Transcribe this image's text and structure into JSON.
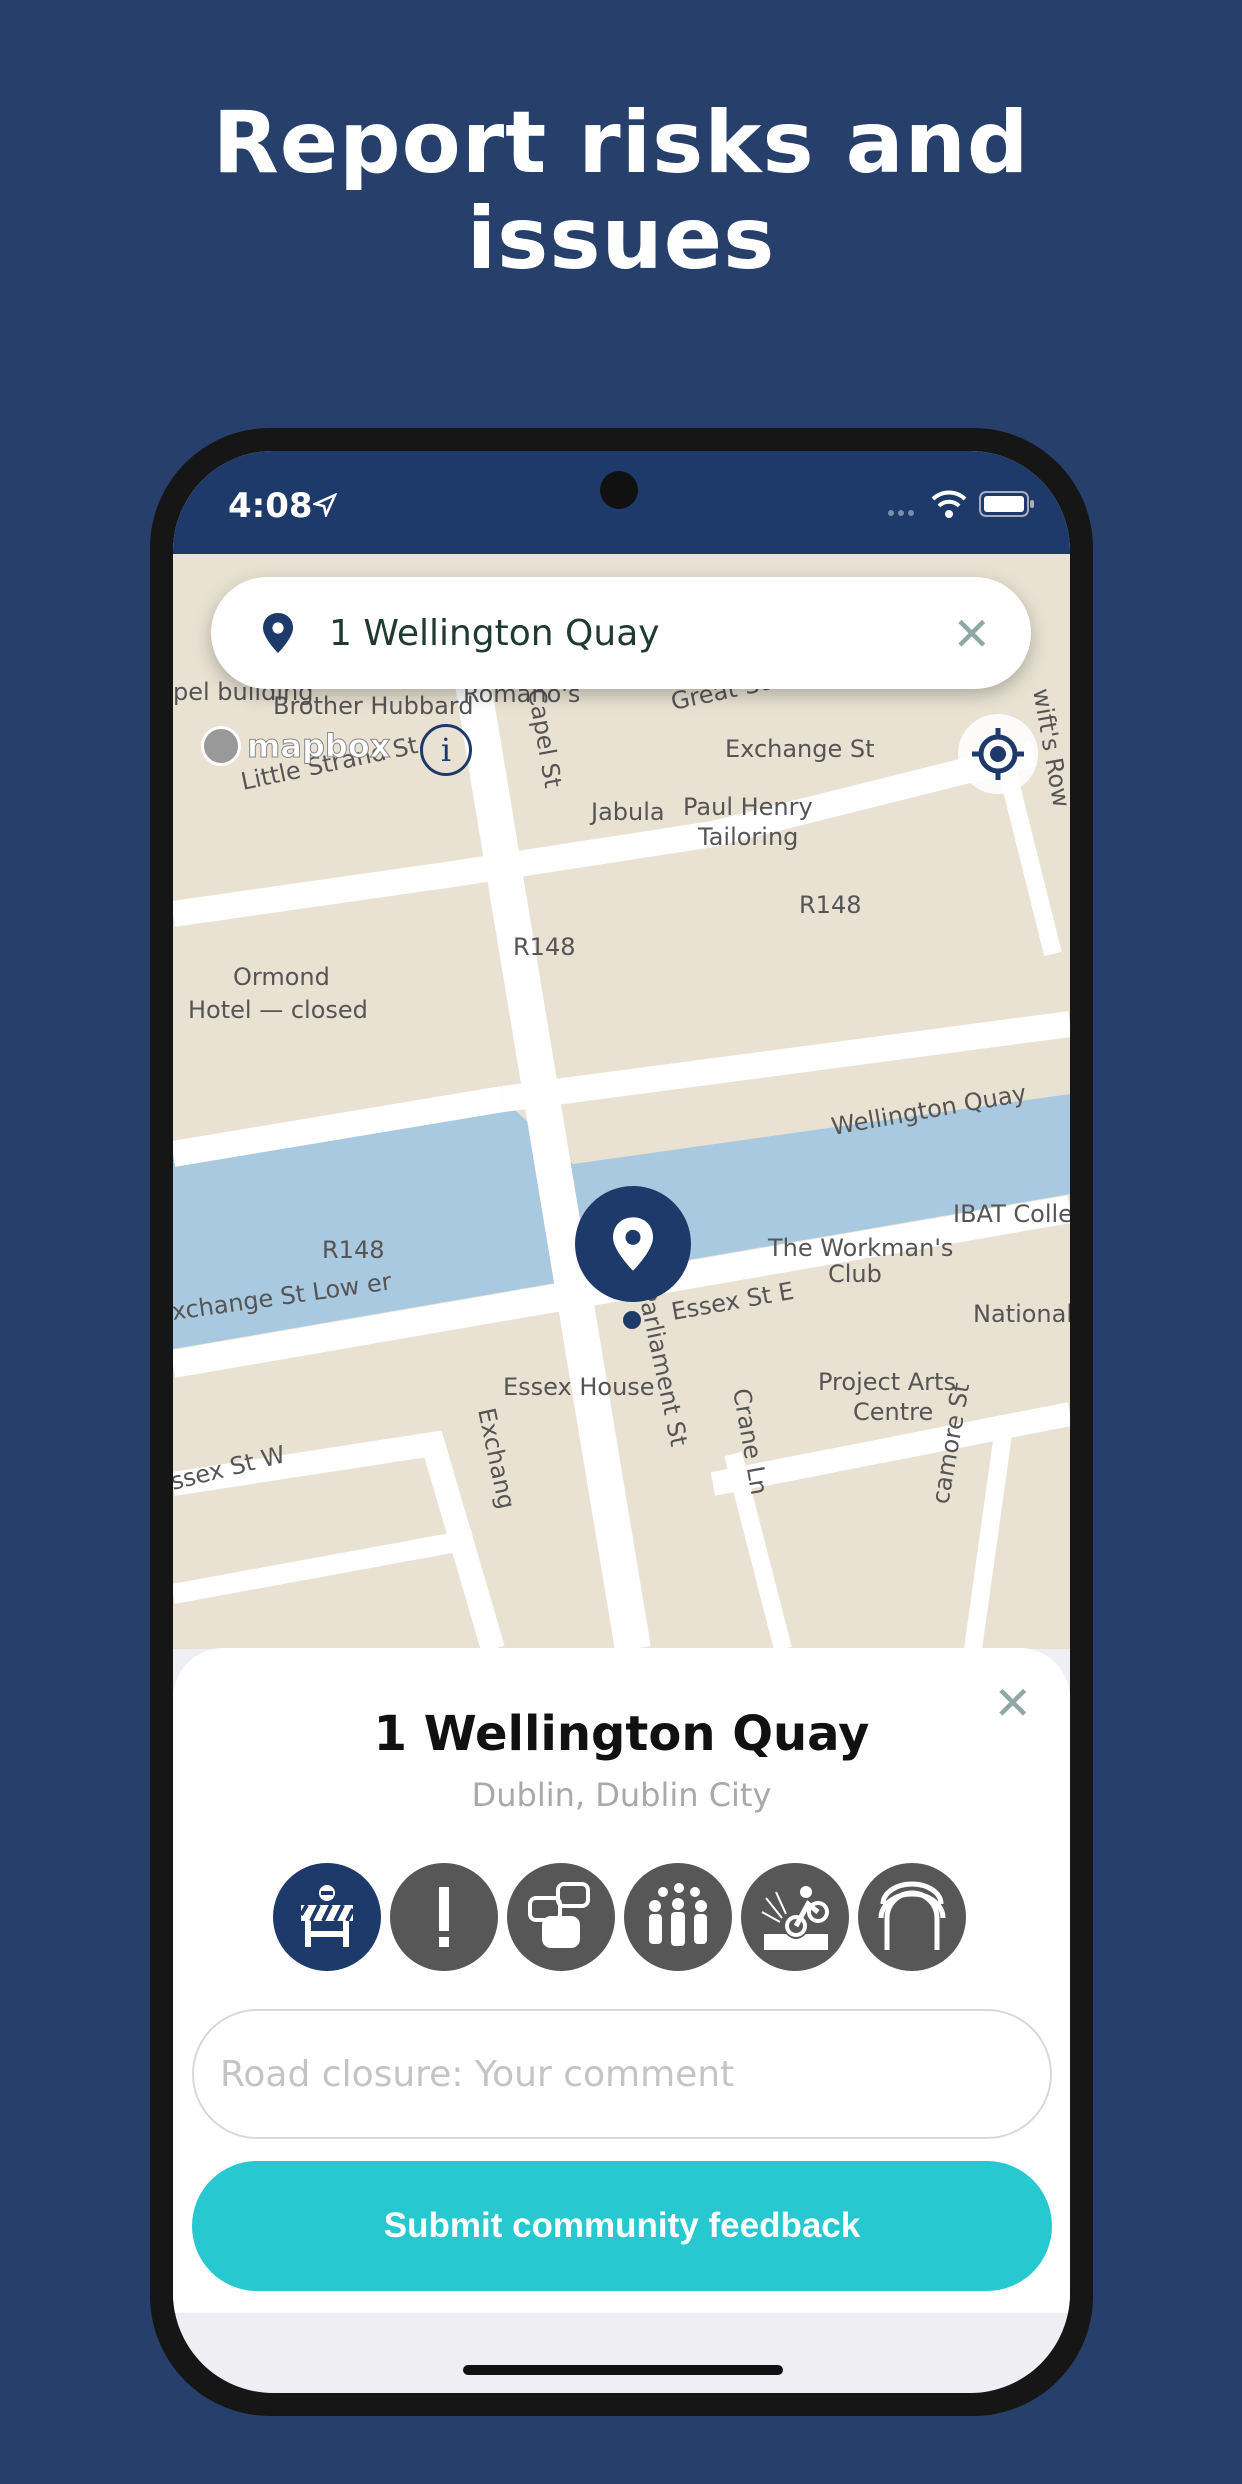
{
  "headline": {
    "line1": "Report risks and",
    "line2": "issues"
  },
  "status_bar": {
    "time": "4:08"
  },
  "search": {
    "value": "1 Wellington Quay",
    "icon": "location-pin-icon",
    "close_icon": "close-icon"
  },
  "map": {
    "attribution": "mapbox",
    "labels": {
      "brother_hubbard": "Brother Hubbard",
      "exchange_st": "Exchange St",
      "great_strand_st": "Great Strand St",
      "swifts_row": "wift's Row",
      "chapel_building": "pel building",
      "romanos": "Romano's",
      "capel_st": "Capel St",
      "little_strand_st": "Little Strand St",
      "jabula": "Jabula",
      "paul_henry": "Paul Henry",
      "tailoring": "Tailoring",
      "r148": "R148",
      "ormond": "Ormond",
      "hotel_closed": "Hotel — closed",
      "wellington_quay": "Wellington Quay",
      "ibat": "IBAT Colle",
      "workmans": "The Workman's",
      "club": "Club",
      "exchange_st_lower": "xchange St Low er",
      "essex_st_e": "Essex St E",
      "national": "National",
      "parliament_st": "Parliament St",
      "essex_house": "Essex House",
      "project_arts": "Project Arts",
      "centre": "Centre",
      "crane_ln": "Crane Ln",
      "sycamore_st": "camore St",
      "essex_st_w": "ssex St W",
      "exchange_short": "Exchang"
    },
    "colors": {
      "land": "#e9e2d3",
      "water": "#a8c9e0",
      "road": "#ffffff",
      "pin": "#1e3a6b"
    }
  },
  "sheet": {
    "title": "1 Wellington Quay",
    "subtitle": "Dublin, Dublin City",
    "categories": [
      {
        "icon": "road-closure-icon",
        "selected": true
      },
      {
        "icon": "warning-icon",
        "selected": false
      },
      {
        "icon": "traffic-icon",
        "selected": false
      },
      {
        "icon": "crowd-icon",
        "selected": false
      },
      {
        "icon": "pothole-bike-icon",
        "selected": false
      },
      {
        "icon": "tunnel-icon",
        "selected": false
      }
    ],
    "comment_placeholder": "Road closure: Your comment",
    "submit_label": "Submit community feedback"
  },
  "colors": {
    "background": "#273f6b",
    "primary": "#1e3a6b",
    "accent": "#27c8d0"
  }
}
